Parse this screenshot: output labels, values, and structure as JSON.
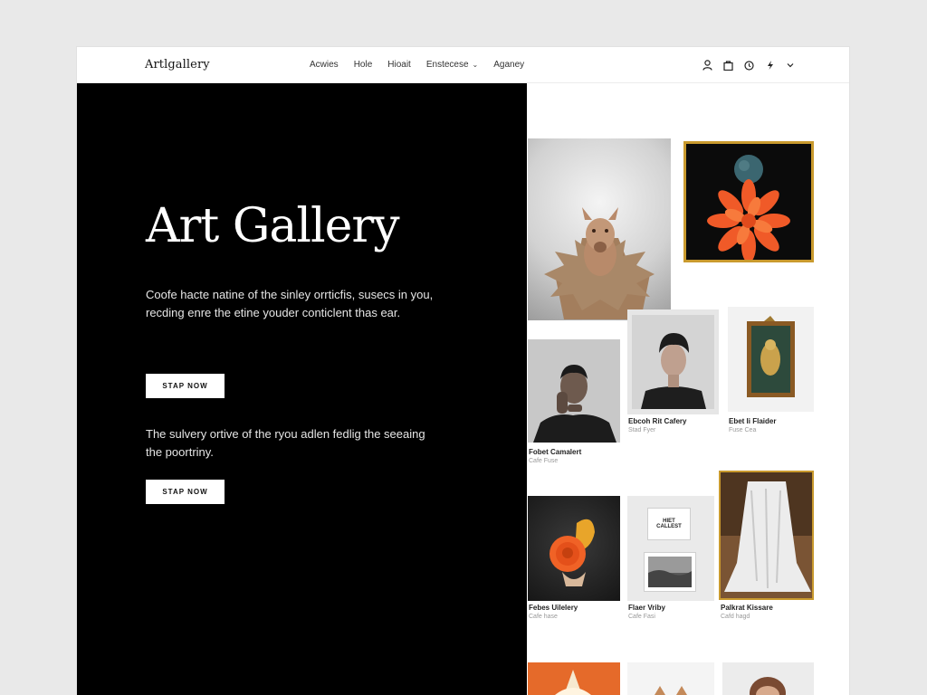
{
  "brand": {
    "logo": "Artlgallery"
  },
  "nav": {
    "items": [
      {
        "label": "Acwies"
      },
      {
        "label": "Hole"
      },
      {
        "label": "Hioait"
      },
      {
        "label": "Enstecese",
        "dropdown": true
      },
      {
        "label": "Aganey"
      }
    ]
  },
  "header_icons": [
    "user-icon",
    "bag-icon",
    "clock-icon",
    "bolt-icon",
    "chevron-down-icon"
  ],
  "hero": {
    "title": "Art Gallery",
    "description": "Coofe hacte natine of the sinley orrticfis, susecs in you, recding enre the etine youder conticlent thas ear.",
    "button1": "STAP NOW",
    "description2": "The sulvery ortive of the ryou adlen fedlig the seeaing the poortriny.",
    "button2": "STAP NOW"
  },
  "gallery": {
    "captions": [
      {
        "title": "Fobet Camalert",
        "sub": "Cafe Fuse"
      },
      {
        "title": "Ebcoh Rit Cafery",
        "sub": "Stad Fyer"
      },
      {
        "title": "Ebet Ii Flaider",
        "sub": "Fuse Cea"
      },
      {
        "title": "Febes Uilelery",
        "sub": "Cafe hase"
      },
      {
        "title": "Flaer Vriby",
        "sub": "Cafe Fasi"
      },
      {
        "title": "Palkrat Kissare",
        "sub": "Cafd hagd"
      }
    ],
    "sign_text_line1": "HIET",
    "sign_text_line2": "CALLEST"
  },
  "colors": {
    "hero_bg": "#000000",
    "frame_gold": "#c99a2e",
    "flower_orange": "#f05a28"
  }
}
